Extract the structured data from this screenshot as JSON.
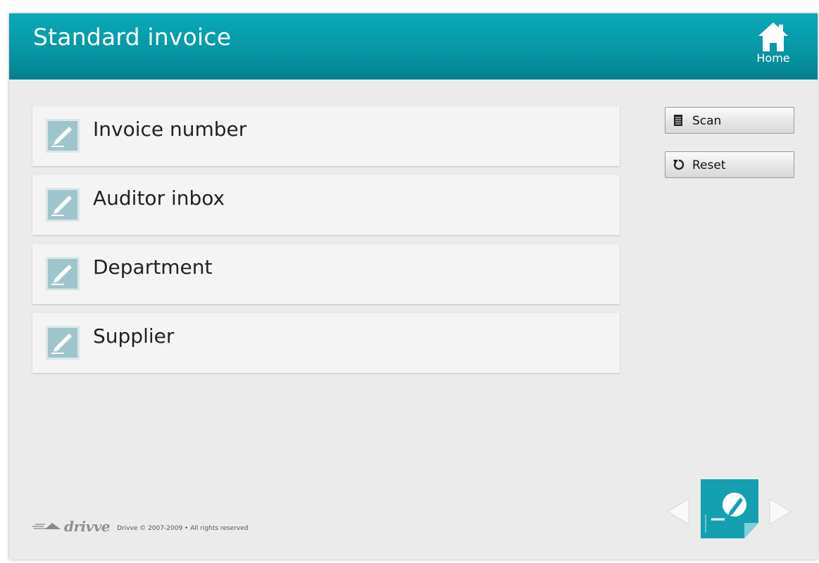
{
  "header": {
    "title": "Standard invoice",
    "home_label": "Home"
  },
  "fields": [
    {
      "label": "Invoice number",
      "icon": "edit-pen-icon"
    },
    {
      "label": "Auditor inbox",
      "icon": "edit-pen-icon"
    },
    {
      "label": "Department",
      "icon": "edit-pen-icon"
    },
    {
      "label": "Supplier",
      "icon": "edit-pen-icon"
    }
  ],
  "actions": {
    "scan_label": "Scan",
    "reset_label": "Reset"
  },
  "footer": {
    "logo_text": "drivve",
    "copyright": "Drivve © 2007-2009 • All rights reserved"
  },
  "colors": {
    "header_accent": "#0797a6",
    "field_icon_bg": "#9ec5cb",
    "document_icon_bg": "#14a0b0"
  }
}
